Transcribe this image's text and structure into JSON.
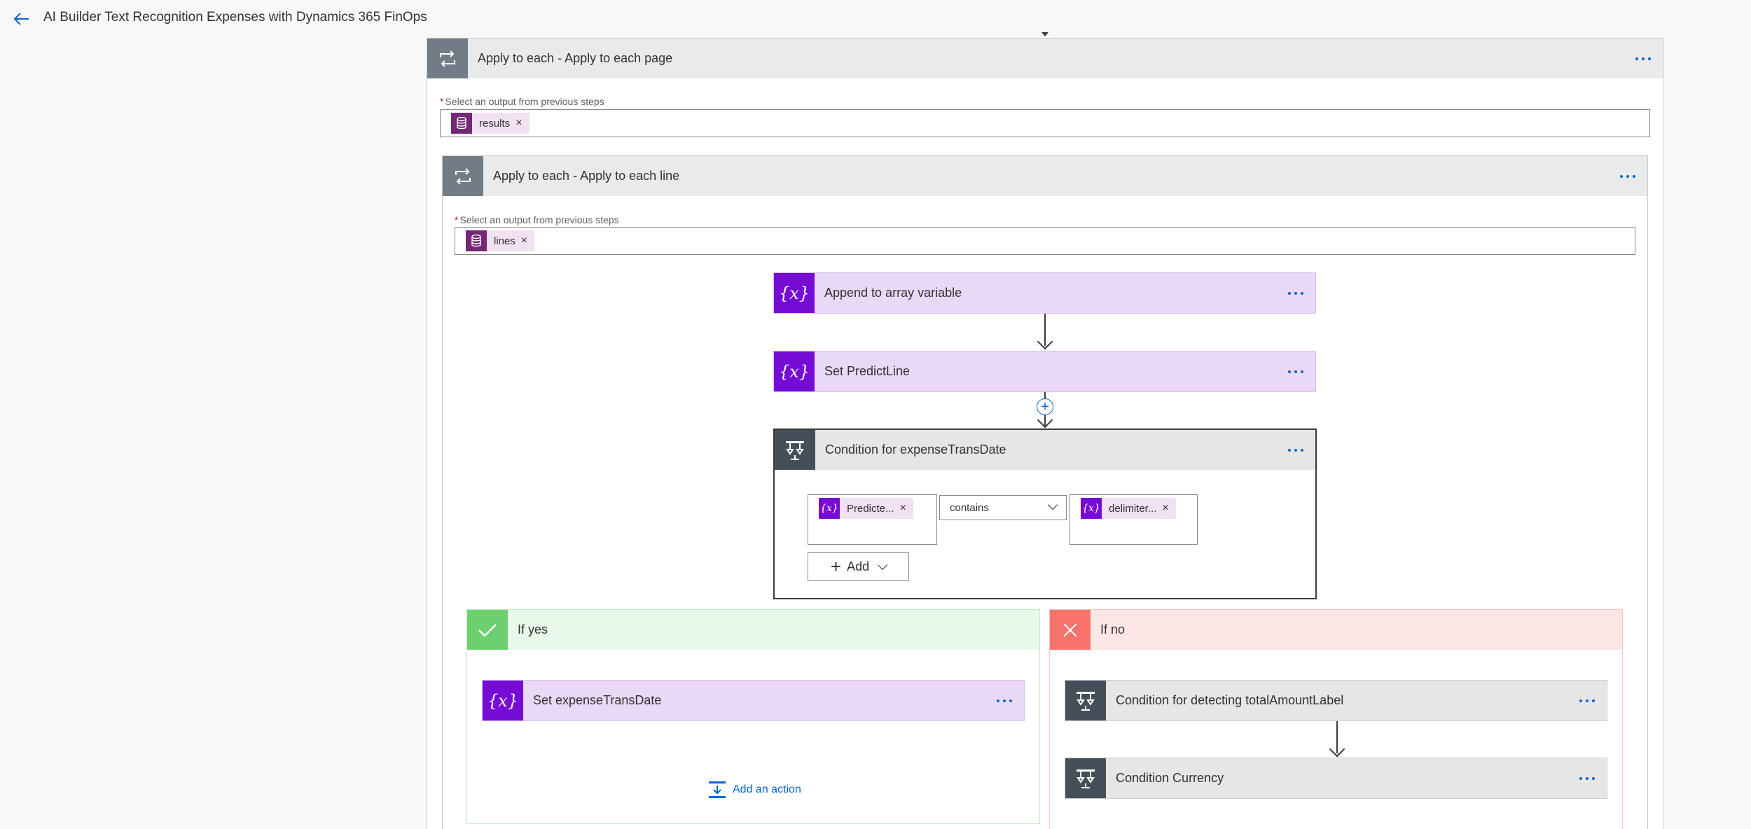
{
  "header": {
    "title": "AI Builder Text Recognition Expenses with Dynamics 365 FinOps",
    "back_icon": "back-arrow-icon"
  },
  "outer_loop": {
    "title": "Apply to each - Apply to each page",
    "icon": "loop-icon",
    "field_label": "Select an output from previous steps",
    "required_mark": "*",
    "token": "results",
    "token_icon": "database-icon"
  },
  "inner_loop": {
    "title": "Apply to each - Apply to each line",
    "icon": "loop-icon",
    "field_label": "Select an output from previous steps",
    "required_mark": "*",
    "token": "lines",
    "token_icon": "database-icon"
  },
  "steps": [
    {
      "title": "Append to array variable",
      "icon": "variable-icon"
    },
    {
      "title": "Set PredictLine",
      "icon": "variable-icon"
    }
  ],
  "condition": {
    "title": "Condition for expenseTransDate",
    "icon": "condition-icon",
    "left_token": "Predicte...",
    "operator": "contains",
    "right_token": "delimiter...",
    "add_label": "Add"
  },
  "branch_yes": {
    "label": "If yes",
    "icon": "check-icon",
    "action": "Set expenseTransDate",
    "add_action": "Add an action"
  },
  "branch_no": {
    "label": "If no",
    "icon": "close-icon",
    "actions": [
      "Condition for detecting totalAmountLabel",
      "Condition Currency"
    ]
  },
  "colors": {
    "accent": "#0a64d4",
    "variable": "#770bd6",
    "variable_bg": "#ead8f7",
    "yes": "#6dd06f",
    "no": "#f7736b"
  }
}
